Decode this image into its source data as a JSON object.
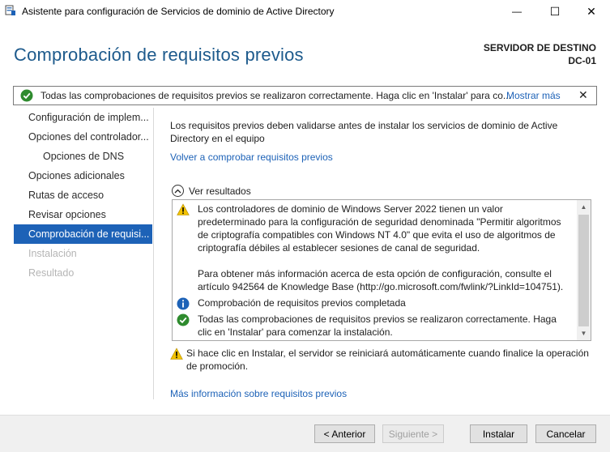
{
  "window": {
    "title": "Asistente para configuración de Servicios de dominio de Active Directory",
    "minimize_glyph": "—",
    "maximize_glyph": "☐",
    "close_glyph": "✕"
  },
  "header": {
    "page_title": "Comprobación de requisitos previos",
    "dest_label": "SERVIDOR DE DESTINO",
    "dest_server": "DC-01"
  },
  "notification": {
    "icon": "success-check-icon",
    "message": "Todas las comprobaciones de requisitos previos se realizaron correctamente. Haga clic en 'Instalar' para co...",
    "more_link": "Mostrar más",
    "close_glyph": "✕"
  },
  "sidebar": {
    "items": [
      {
        "label": "Configuración de implem...",
        "state": "normal"
      },
      {
        "label": "Opciones del controlador...",
        "state": "normal"
      },
      {
        "label": "Opciones de DNS",
        "state": "sub"
      },
      {
        "label": "Opciones adicionales",
        "state": "normal"
      },
      {
        "label": "Rutas de acceso",
        "state": "normal"
      },
      {
        "label": "Revisar opciones",
        "state": "normal"
      },
      {
        "label": "Comprobación de requisi...",
        "state": "active"
      },
      {
        "label": "Instalación",
        "state": "disabled"
      },
      {
        "label": "Resultado",
        "state": "disabled"
      }
    ]
  },
  "main": {
    "intro": "Los requisitos previos deben validarse antes de instalar los servicios de dominio de Active Directory en el equipo",
    "recheck_link": "Volver a comprobar requisitos previos",
    "results_toggle": "Ver resultados",
    "results": [
      {
        "icon": "warning-icon",
        "text": "Los controladores de dominio de Windows Server 2022 tienen un valor predeterminado para la configuración de seguridad denominada \"Permitir algoritmos de criptografía compatibles con Windows NT 4.0\" que evita el uso de algoritmos de criptografía débiles al establecer sesiones de canal de seguridad."
      },
      {
        "icon": "",
        "text": "Para obtener más información acerca de esta opción de configuración, consulte el artículo 942564 de Knowledge Base (http://go.microsoft.com/fwlink/?LinkId=104751)."
      },
      {
        "icon": "info-icon",
        "text": "Comprobación de requisitos previos completada"
      },
      {
        "icon": "success-check-icon",
        "text": "Todas las comprobaciones de requisitos previos se realizaron correctamente. Haga clic en 'Instalar' para comenzar la instalación."
      }
    ],
    "warning_note": "Si hace clic en Instalar, el servidor se reiniciará automáticamente cuando finalice la operación de promoción.",
    "more_info_link": "Más información sobre requisitos previos"
  },
  "footer": {
    "prev": "< Anterior",
    "next": "Siguiente >",
    "install": "Instalar",
    "cancel": "Cancelar"
  },
  "colors": {
    "accent": "#1d62b7",
    "title": "#1d5a8c",
    "success": "#2e8b2e",
    "warning": "#f2c200",
    "info": "#1d62b7"
  }
}
